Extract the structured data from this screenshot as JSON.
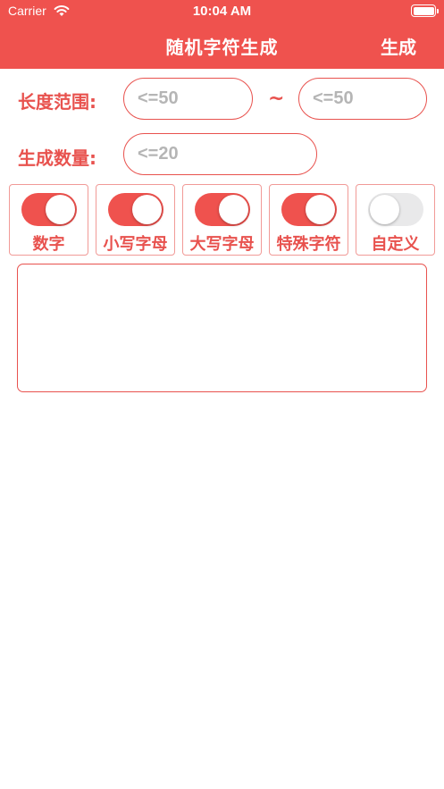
{
  "status_bar": {
    "carrier": "Carrier",
    "time": "10:04 AM"
  },
  "nav": {
    "title": "随机字符生成",
    "generate_label": "生成"
  },
  "length": {
    "label": "长度范围:",
    "min_placeholder": "<=50",
    "separator": "~",
    "max_placeholder": "<=50"
  },
  "count": {
    "label": "生成数量:",
    "placeholder": "<=20"
  },
  "toggles": [
    {
      "label": "数字",
      "on": true
    },
    {
      "label": "小写字母",
      "on": true
    },
    {
      "label": "大写字母",
      "on": true
    },
    {
      "label": "特殊字符",
      "on": true
    },
    {
      "label": "自定义",
      "on": false
    }
  ],
  "colors": {
    "accent": "#ef524e",
    "switch_off": "#e9e9ea"
  }
}
